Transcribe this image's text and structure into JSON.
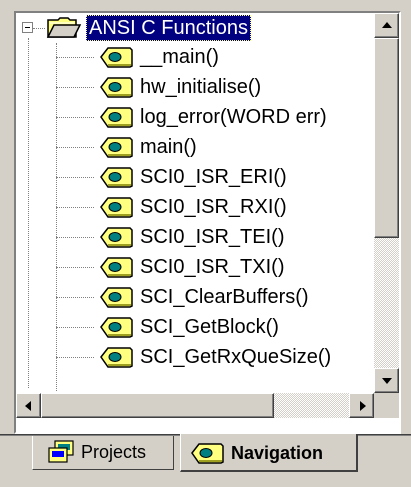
{
  "tree": {
    "root_label": "ANSI C Functions",
    "items": [
      {
        "label": "__main()"
      },
      {
        "label": "hw_initialise()"
      },
      {
        "label": "log_error(WORD err)"
      },
      {
        "label": "main()"
      },
      {
        "label": "SCI0_ISR_ERI()"
      },
      {
        "label": "SCI0_ISR_RXI()"
      },
      {
        "label": "SCI0_ISR_TEI()"
      },
      {
        "label": "SCI0_ISR_TXI()"
      },
      {
        "label": "SCI_ClearBuffers()"
      },
      {
        "label": "SCI_GetBlock()"
      },
      {
        "label": "SCI_GetRxQueSize()"
      }
    ]
  },
  "tabs": [
    {
      "label": "Projects",
      "icon": "projects-icon",
      "active": false
    },
    {
      "label": "Navigation",
      "icon": "function-icon",
      "active": true
    }
  ],
  "colors": {
    "selection_bg": "#000080",
    "folder_yellow": "#ffff80",
    "function_tag": "#ffff80"
  }
}
